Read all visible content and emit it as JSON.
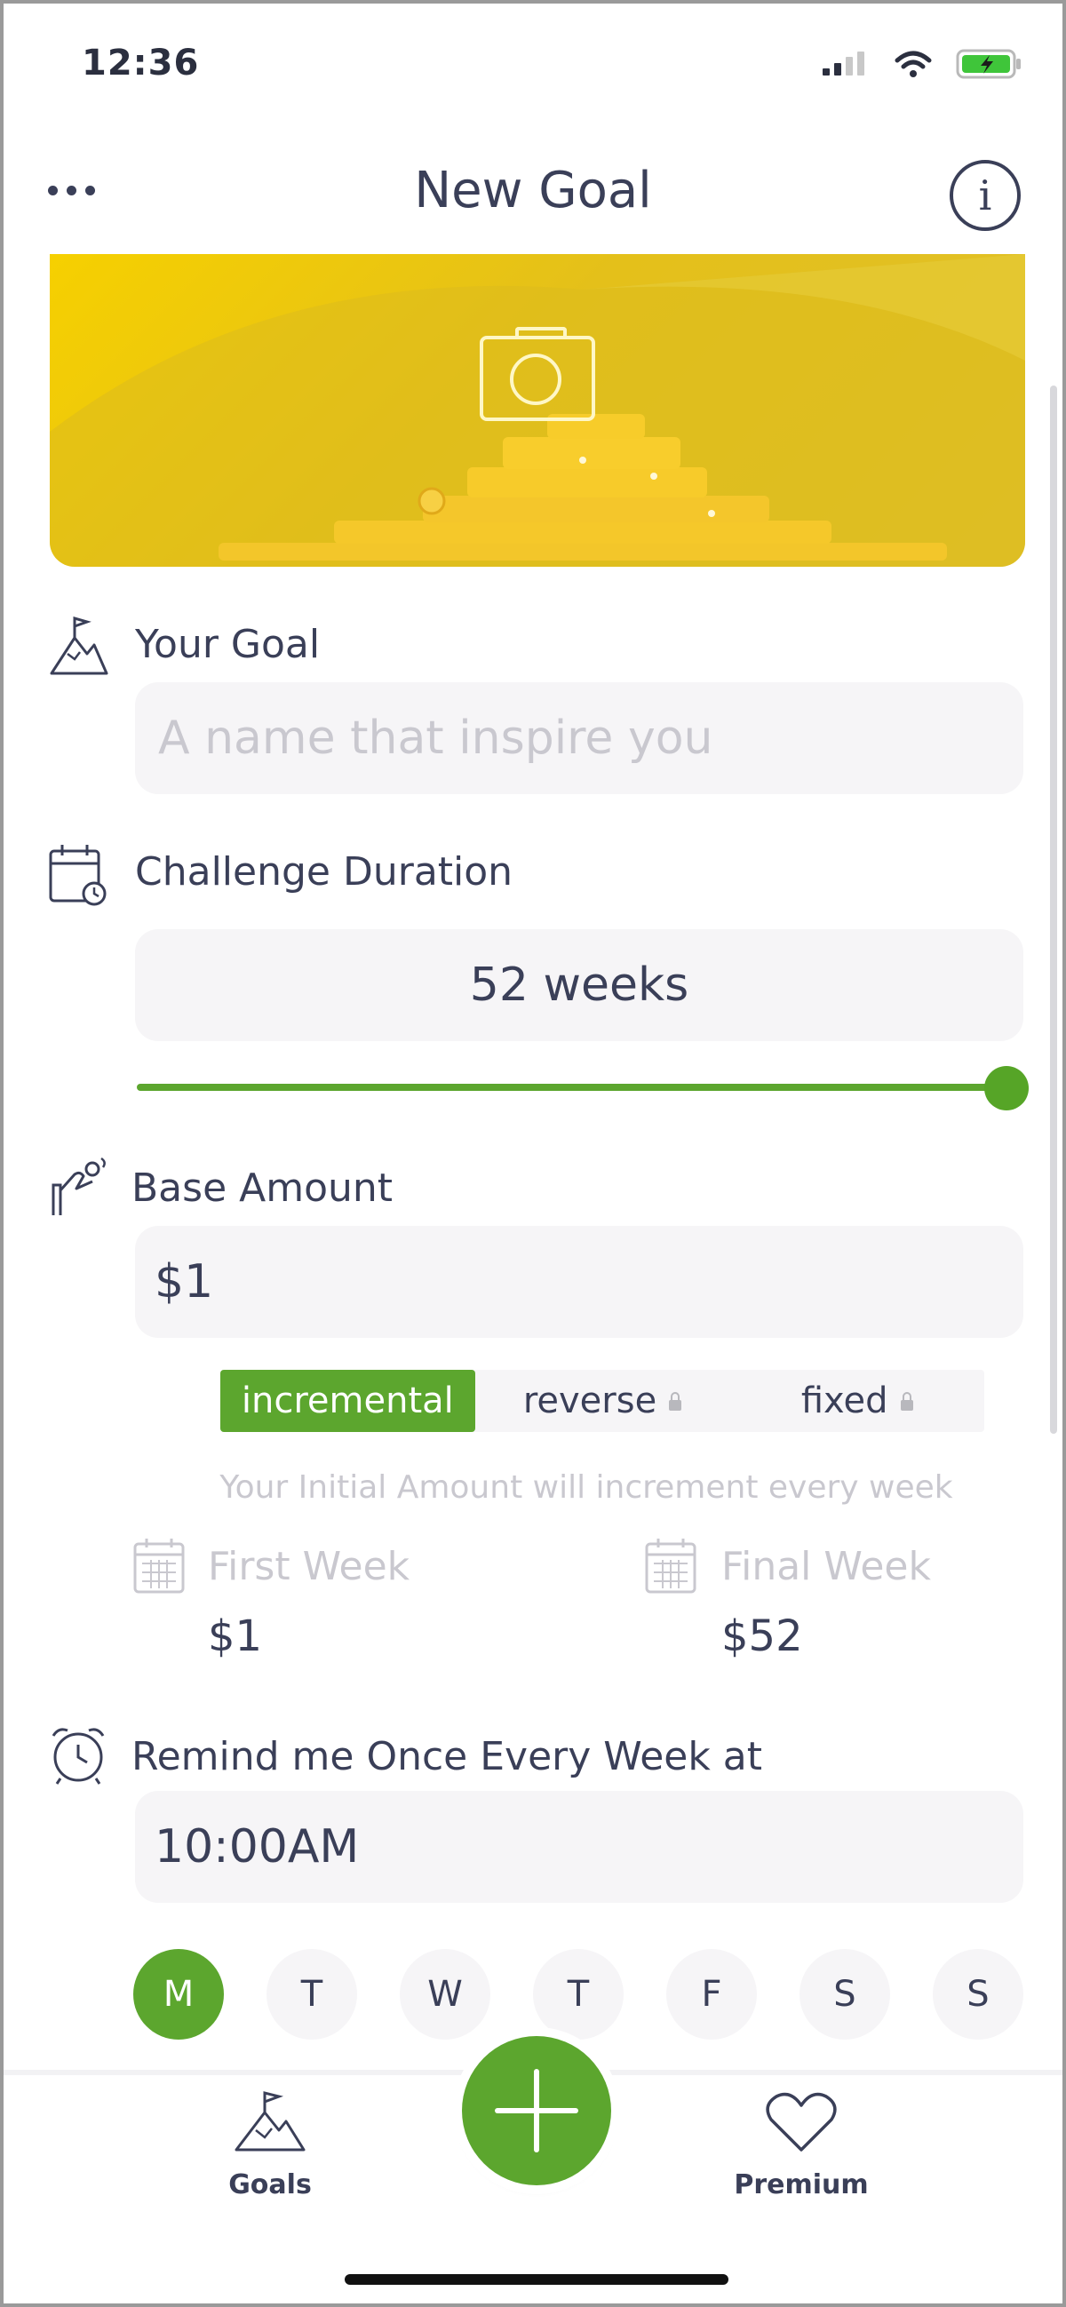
{
  "status_bar": {
    "time": "12:36"
  },
  "header": {
    "title": "New Goal",
    "info_symbol": "i"
  },
  "goal": {
    "label": "Your Goal",
    "placeholder": "A name that inspire you"
  },
  "duration": {
    "label": "Challenge Duration",
    "value": "52 weeks",
    "slider_fraction": 1.0
  },
  "base_amount": {
    "label": "Base Amount",
    "value": "$1",
    "modes": [
      {
        "label": "incremental",
        "active": true,
        "locked": false
      },
      {
        "label": "reverse",
        "active": false,
        "locked": true
      },
      {
        "label": "fixed",
        "active": false,
        "locked": true
      }
    ],
    "hint": "Your Initial Amount will increment every week"
  },
  "weeks": {
    "first_label": "First Week",
    "first_value": "$1",
    "final_label": "Final Week",
    "final_value": "$52"
  },
  "reminder": {
    "label": "Remind me Once Every Week at",
    "time": "10:00AM",
    "days": [
      {
        "label": "M",
        "active": true
      },
      {
        "label": "T",
        "active": false
      },
      {
        "label": "W",
        "active": false
      },
      {
        "label": "T",
        "active": false
      },
      {
        "label": "F",
        "active": false
      },
      {
        "label": "S",
        "active": false
      },
      {
        "label": "S",
        "active": false
      }
    ]
  },
  "tabbar": {
    "goals_label": "Goals",
    "premium_label": "Premium"
  },
  "colors": {
    "accent": "#5ca62e",
    "banner": "#f2cc0c",
    "text": "#3a3f58",
    "placeholder": "#c9c8cf",
    "field_bg": "#f6f5f7"
  },
  "icons": [
    "menu-dots-icon",
    "info-icon",
    "camera-icon",
    "mountain-flag-icon",
    "calendar-clock-icon",
    "hand-coin-icon",
    "lock-icon",
    "calendar-icon",
    "alarm-clock-icon",
    "plus-icon",
    "heart-icon",
    "wifi-icon",
    "battery-icon",
    "signal-icon"
  ]
}
